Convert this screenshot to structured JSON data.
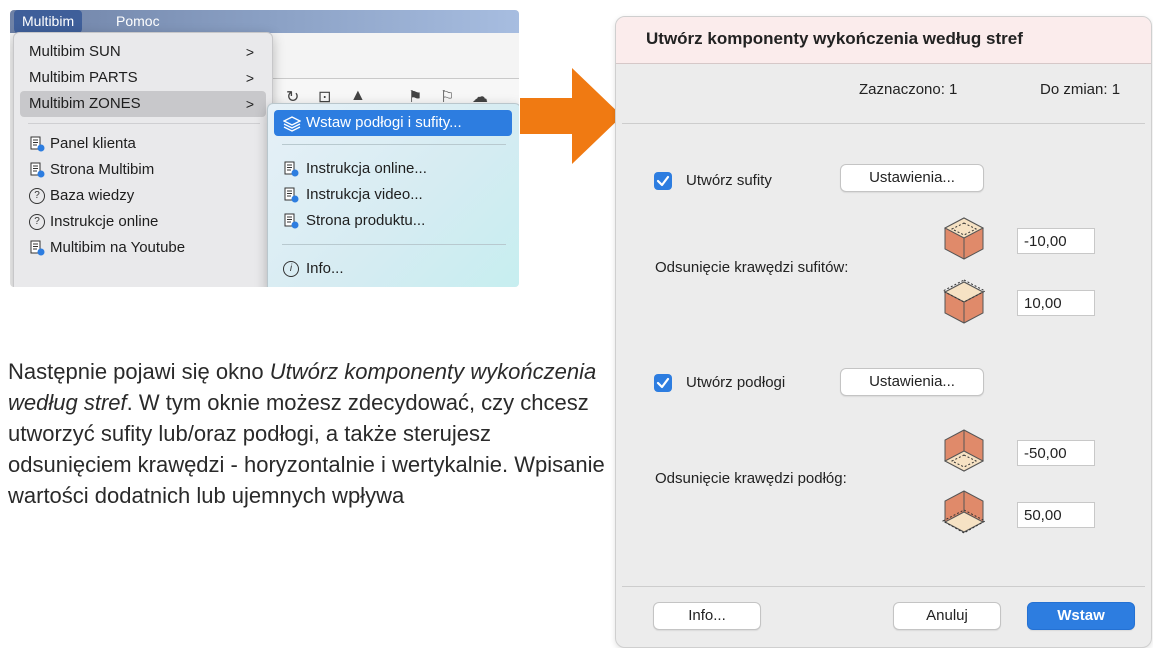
{
  "menubar": {
    "items": [
      {
        "label": "Multibim"
      },
      {
        "label": "Pomoc"
      }
    ]
  },
  "dropdown": {
    "items": [
      {
        "label": "Multibim SUN",
        "arrow": ">"
      },
      {
        "label": "Multibim PARTS",
        "arrow": ">"
      },
      {
        "label": "Multibim ZONES",
        "arrow": ">"
      },
      {
        "label": "Panel klienta"
      },
      {
        "label": "Strona Multibim"
      },
      {
        "label": "Baza wiedzy"
      },
      {
        "label": "Instrukcje online"
      },
      {
        "label": "Multibim na Youtube"
      }
    ]
  },
  "submenu": {
    "items": [
      {
        "label": "Wstaw podłogi i sufity..."
      },
      {
        "label": "Instrukcja online..."
      },
      {
        "label": "Instrukcja video..."
      },
      {
        "label": "Strona produktu..."
      },
      {
        "label": "Info..."
      }
    ]
  },
  "paragraph": {
    "prefix": "Następnie pojawi się okno ",
    "italic": "Utwórz komponenty wykończenia według stref",
    "suffix": ". W tym oknie możesz zdecydować, czy chcesz utworzyć sufity lub/oraz podłogi, a także sterujesz odsunięciem krawędzi - horyzontalnie i wertykalnie. Wpisanie wartości dodatnich lub ujemnych wpływa"
  },
  "dialog": {
    "title": "Utwórz komponenty wykończenia według stref",
    "selected_label": "Zaznaczono: 1",
    "to_change_label": "Do zmian: 1",
    "ceilings": {
      "checkbox_label": "Utwórz sufity",
      "checked": true,
      "settings_button": "Ustawienia...",
      "offset_label": "Odsunięcie krawędzi sufitów:",
      "value_top": "-10,00",
      "value_bottom": "10,00"
    },
    "floors": {
      "checkbox_label": "Utwórz podłogi",
      "checked": true,
      "settings_button": "Ustawienia...",
      "offset_label": "Odsunięcie krawędzi podłóg:",
      "value_top": "-50,00",
      "value_bottom": "50,00"
    },
    "info_button": "Info...",
    "cancel_button": "Anuluj",
    "insert_button": "Wstaw"
  },
  "colors": {
    "accent": "#2d7de0",
    "arrow": "#f07a12",
    "title_bg": "#fbecec"
  }
}
